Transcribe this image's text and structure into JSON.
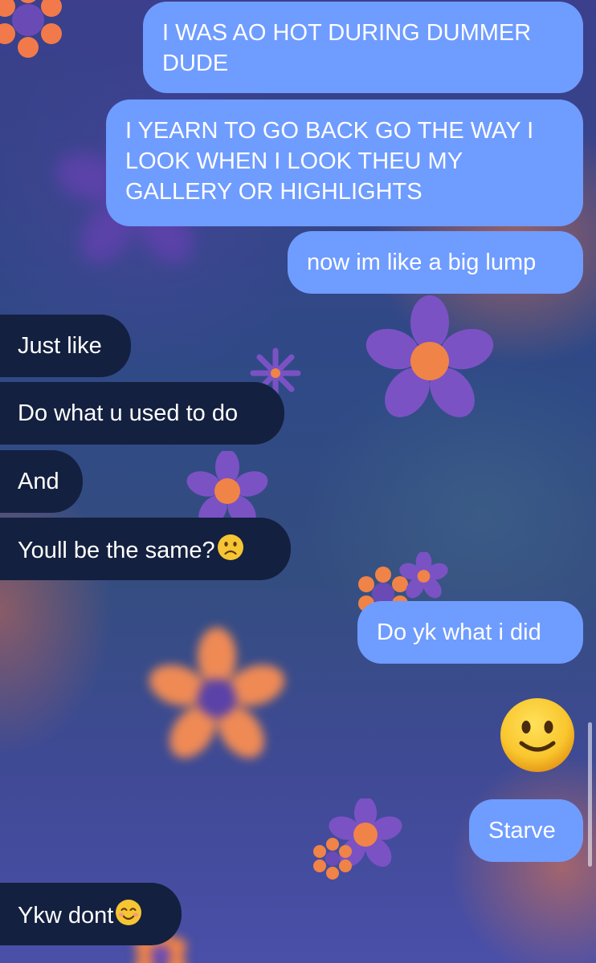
{
  "colors": {
    "outgoing_bubble": "#6f9cff",
    "incoming_bubble": "#14203f",
    "bubble_text": "#ffffff"
  },
  "messages": [
    {
      "direction": "outgoing",
      "text": "I WAS AO HOT DURING DUMMER DUDE"
    },
    {
      "direction": "outgoing",
      "text": "I YEARN TO GO BACK GO THE WAY I LOOK WHEN I LOOK THEU MY GALLERY OR HIGHLIGHTS"
    },
    {
      "direction": "outgoing",
      "text": "now im like a big lump"
    },
    {
      "direction": "incoming",
      "text": "Just like"
    },
    {
      "direction": "incoming",
      "text": "Do what u used to do"
    },
    {
      "direction": "incoming",
      "text": "And"
    },
    {
      "direction": "incoming",
      "text": "Youll be the same?",
      "emoji": "slightly-frowning-face-icon"
    },
    {
      "direction": "outgoing",
      "text": "Do yk what i did"
    },
    {
      "direction": "outgoing",
      "emoji": "slightly-smiling-face-icon"
    },
    {
      "direction": "outgoing",
      "text": "Starve"
    },
    {
      "direction": "incoming",
      "text": "Ykw dont",
      "emoji": "smiling-face-with-smiling-eyes-icon"
    }
  ]
}
